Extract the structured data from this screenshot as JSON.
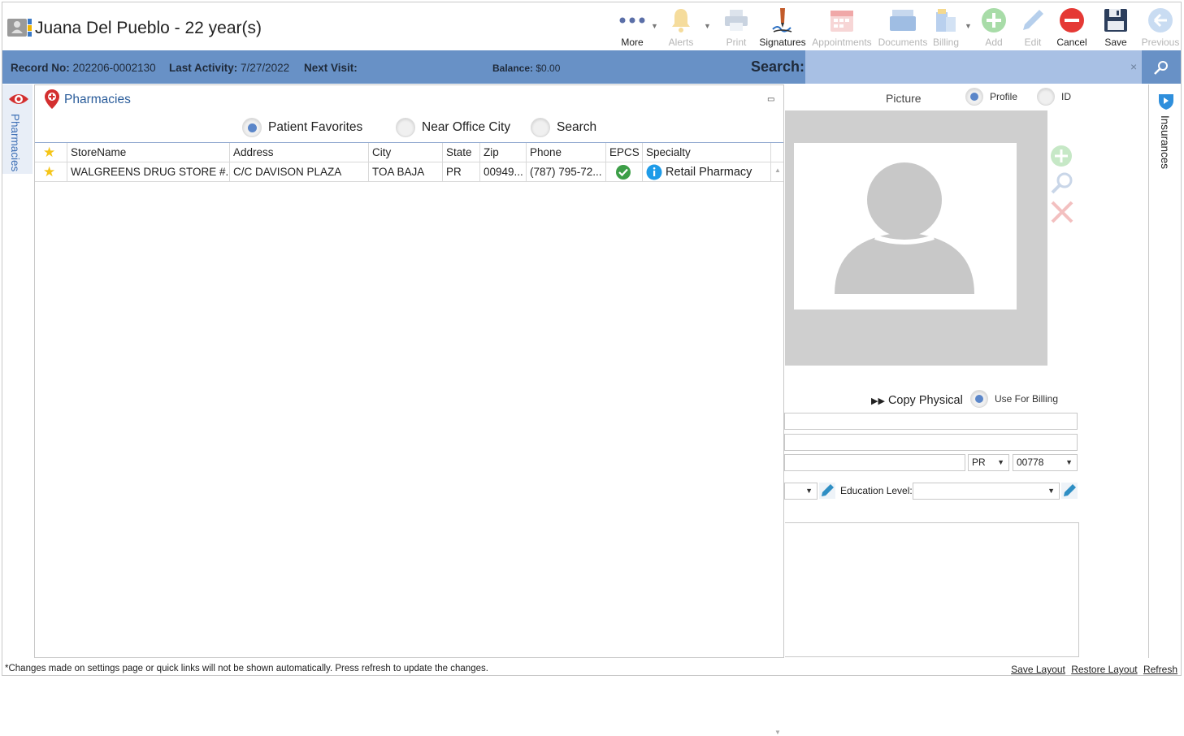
{
  "header": {
    "patient_name": "Juana Del Pueblo - 22 year(s)",
    "toolbar": [
      {
        "label": "More",
        "icon": "more-dots-icon",
        "enabled": true
      },
      {
        "label": "Alerts",
        "icon": "bell-icon",
        "enabled": false
      },
      {
        "label": "Print",
        "icon": "printer-icon",
        "enabled": false
      },
      {
        "label": "Signatures",
        "icon": "signature-pen-icon",
        "enabled": true
      },
      {
        "label": "Appointments",
        "icon": "calendar-icon",
        "enabled": false
      },
      {
        "label": "Documents",
        "icon": "documents-icon",
        "enabled": false
      },
      {
        "label": "Billing",
        "icon": "billing-icon",
        "enabled": false
      },
      {
        "label": "Add",
        "icon": "plus-circle-icon",
        "enabled": false
      },
      {
        "label": "Edit",
        "icon": "pencil-icon",
        "enabled": false
      },
      {
        "label": "Cancel",
        "icon": "cancel-circle-icon",
        "enabled": true
      },
      {
        "label": "Save",
        "icon": "floppy-icon",
        "enabled": true
      },
      {
        "label": "Previous",
        "icon": "back-arrow-icon",
        "enabled": false
      }
    ]
  },
  "infobar": {
    "record_label": "Record No:",
    "record_value": "202206-0002130",
    "activity_label": "Last Activity:",
    "activity_value": "7/27/2022",
    "next_visit_label": "Next Visit:",
    "next_visit_value": "",
    "balance_label": "Balance:",
    "balance_value": "$0.00",
    "search_label": "Search:",
    "search_value": "",
    "search_clear": "×"
  },
  "left_tab": {
    "label": "Pharmacies"
  },
  "right_tab": {
    "label": "Insurances"
  },
  "pharmacies": {
    "title": "Pharmacies",
    "filters": [
      {
        "label": "Patient Favorites",
        "selected": true
      },
      {
        "label": "Near Office City",
        "selected": false
      },
      {
        "label": "Search",
        "selected": false
      }
    ],
    "columns": [
      "StoreName",
      "Address",
      "City",
      "State",
      "Zip",
      "Phone",
      "EPCS",
      "Specialty"
    ],
    "rows": [
      {
        "favorite": true,
        "store_name": "WALGREENS DRUG STORE #...",
        "address": "C/C DAVISON PLAZA",
        "city": "TOA BAJA",
        "state": "PR",
        "zip": "00949...",
        "phone": "(787) 795-72...",
        "epcs": true,
        "specialty": "Retail Pharmacy"
      }
    ]
  },
  "detail": {
    "picture_label": "Picture",
    "profile_label": "Profile",
    "id_label": "ID",
    "copy_physical": "Copy Physical",
    "use_for_billing": "Use For Billing",
    "state_value": "PR",
    "zip_value": "00778",
    "education_label": "Education Level:",
    "education_value": ""
  },
  "footer": {
    "note": "*Changes made on settings page or quick links will not be shown automatically. Press refresh to update the changes.",
    "save_layout": "Save Layout",
    "restore_layout": "Restore Layout",
    "refresh": "Refresh"
  },
  "colors": {
    "infobar": "#6891c6",
    "search_box": "#a8c0e4",
    "link_blue": "#2a5c9a",
    "radio_on": "#5b86c9"
  }
}
